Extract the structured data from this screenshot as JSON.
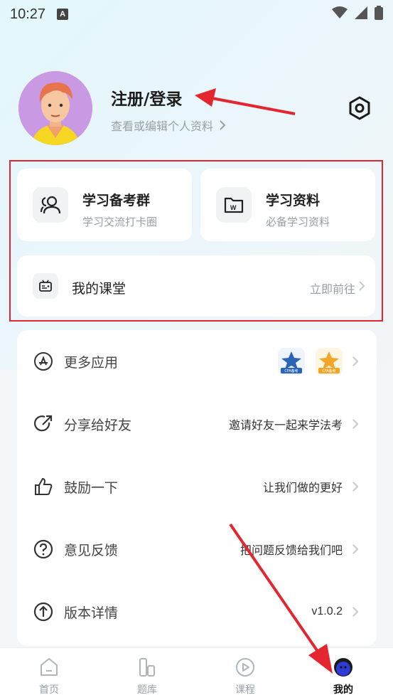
{
  "status_bar": {
    "time": "10:27",
    "notif_letter": "A"
  },
  "profile": {
    "title": "注册/登录",
    "subtitle": "查看或编辑个人资料"
  },
  "cards": {
    "study_group": {
      "title": "学习备考群",
      "subtitle": "学习交流打卡圈"
    },
    "materials": {
      "title": "学习资料",
      "subtitle": "必备学习资料"
    },
    "classroom": {
      "title": "我的课堂",
      "action": "立即前往"
    }
  },
  "list": {
    "more_apps": {
      "label": "更多应用",
      "badge1": "CFA备考",
      "badge2": "CFA备考"
    },
    "share": {
      "label": "分享给好友",
      "value": "邀请好友一起来学法考"
    },
    "encourage": {
      "label": "鼓励一下",
      "value": "让我们做的更好"
    },
    "feedback": {
      "label": "意见反馈",
      "value": "把问题反馈给我们吧"
    },
    "version": {
      "label": "版本详情",
      "value": "v1.0.2"
    }
  },
  "tabbar": {
    "tabs": [
      {
        "label": "首页",
        "icon": "home-icon"
      },
      {
        "label": "题库",
        "icon": "question-bank-icon"
      },
      {
        "label": "课程",
        "icon": "course-play-icon"
      },
      {
        "label": "我的",
        "icon": "profile-avatar-icon"
      }
    ],
    "active_index": 3
  },
  "colors": {
    "annotation_red": "#e3262f",
    "badge_blue": "#2a63b8",
    "badge_orange": "#f2a526"
  }
}
